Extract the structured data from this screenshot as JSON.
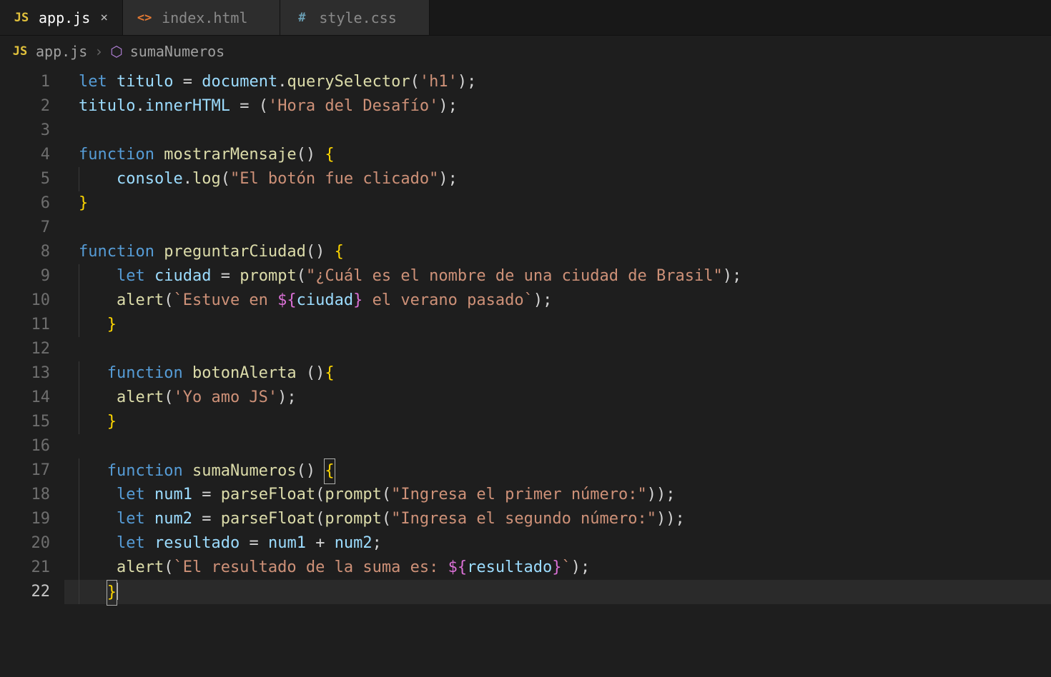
{
  "tabs": [
    {
      "label": "app.js",
      "icon": "JS",
      "iconClass": "js-icon",
      "active": true
    },
    {
      "label": "index.html",
      "icon": "<>",
      "iconClass": "html-icon",
      "active": false
    },
    {
      "label": "style.css",
      "icon": "#",
      "iconClass": "css-icon",
      "active": false
    }
  ],
  "breadcrumbs": {
    "fileIcon": "JS",
    "file": "app.js",
    "sep": "›",
    "symbolIcon": "⬡",
    "symbol": "sumaNumeros"
  },
  "close_icon": "×",
  "code": {
    "line_count": 22,
    "cursor_line": 22,
    "lines": {
      "l1": [
        [
          "kw",
          "let"
        ],
        [
          "pun",
          " "
        ],
        [
          "var",
          "titulo"
        ],
        [
          "pun",
          " "
        ],
        [
          "pun",
          "="
        ],
        [
          "pun",
          " "
        ],
        [
          "var",
          "document"
        ],
        [
          "pun",
          "."
        ],
        [
          "fn",
          "querySelector"
        ],
        [
          "pun",
          "("
        ],
        [
          "str",
          "'h1'"
        ],
        [
          "pun",
          ")"
        ],
        [
          "pun",
          ";"
        ]
      ],
      "l2": [
        [
          "var",
          "titulo"
        ],
        [
          "pun",
          "."
        ],
        [
          "var",
          "innerHTML"
        ],
        [
          "pun",
          " "
        ],
        [
          "pun",
          "="
        ],
        [
          "pun",
          " "
        ],
        [
          "pun",
          "("
        ],
        [
          "str",
          "'Hora del Desafío'"
        ],
        [
          "pun",
          ")"
        ],
        [
          "pun",
          ";"
        ]
      ],
      "l3": [],
      "l4": [
        [
          "kw",
          "function"
        ],
        [
          "pun",
          " "
        ],
        [
          "fn",
          "mostrarMensaje"
        ],
        [
          "pun",
          "()"
        ],
        [
          "pun",
          " "
        ],
        [
          "brace1",
          "{"
        ]
      ],
      "l5": [
        [
          "pun",
          "    "
        ],
        [
          "var",
          "console"
        ],
        [
          "pun",
          "."
        ],
        [
          "fn",
          "log"
        ],
        [
          "pun",
          "("
        ],
        [
          "str",
          "\"El botón fue clicado\""
        ],
        [
          "pun",
          ")"
        ],
        [
          "pun",
          ";"
        ]
      ],
      "l6": [
        [
          "brace1",
          "}"
        ]
      ],
      "l7": [],
      "l8": [
        [
          "kw",
          "function"
        ],
        [
          "pun",
          " "
        ],
        [
          "fn",
          "preguntarCiudad"
        ],
        [
          "pun",
          "()"
        ],
        [
          "pun",
          " "
        ],
        [
          "brace1",
          "{"
        ]
      ],
      "l9": [
        [
          "pun",
          "    "
        ],
        [
          "kw",
          "let"
        ],
        [
          "pun",
          " "
        ],
        [
          "var",
          "ciudad"
        ],
        [
          "pun",
          " "
        ],
        [
          "pun",
          "="
        ],
        [
          "pun",
          " "
        ],
        [
          "fn",
          "prompt"
        ],
        [
          "pun",
          "("
        ],
        [
          "str",
          "\"¿Cuál es el nombre de una ciudad de Brasil\""
        ],
        [
          "pun",
          ")"
        ],
        [
          "pun",
          ";"
        ]
      ],
      "l10": [
        [
          "pun",
          "    "
        ],
        [
          "fn",
          "alert"
        ],
        [
          "pun",
          "("
        ],
        [
          "str",
          "`Estuve en "
        ],
        [
          "brace2",
          "${"
        ],
        [
          "var",
          "ciudad"
        ],
        [
          "brace2",
          "}"
        ],
        [
          "str",
          " el verano pasado`"
        ],
        [
          "pun",
          ")"
        ],
        [
          "pun",
          ";"
        ]
      ],
      "l11": [
        [
          "pun",
          "   "
        ],
        [
          "brace1",
          "}"
        ]
      ],
      "l12": [],
      "l13": [
        [
          "pun",
          "   "
        ],
        [
          "kw",
          "function"
        ],
        [
          "pun",
          " "
        ],
        [
          "fn",
          "botonAlerta"
        ],
        [
          "pun",
          " ()"
        ],
        [
          "brace1",
          "{"
        ]
      ],
      "l14": [
        [
          "pun",
          "    "
        ],
        [
          "fn",
          "alert"
        ],
        [
          "pun",
          "("
        ],
        [
          "str",
          "'Yo amo JS'"
        ],
        [
          "pun",
          ")"
        ],
        [
          "pun",
          ";"
        ]
      ],
      "l15": [
        [
          "pun",
          "   "
        ],
        [
          "brace1",
          "}"
        ]
      ],
      "l16": [],
      "l17": [
        [
          "pun",
          "   "
        ],
        [
          "kw",
          "function"
        ],
        [
          "pun",
          " "
        ],
        [
          "fn",
          "sumaNumeros"
        ],
        [
          "pun",
          "()"
        ],
        [
          "pun",
          " "
        ],
        [
          "brace1box",
          "{"
        ]
      ],
      "l18": [
        [
          "pun",
          "    "
        ],
        [
          "kw",
          "let"
        ],
        [
          "pun",
          " "
        ],
        [
          "var",
          "num1"
        ],
        [
          "pun",
          " "
        ],
        [
          "pun",
          "="
        ],
        [
          "pun",
          " "
        ],
        [
          "fn",
          "parseFloat"
        ],
        [
          "pun",
          "("
        ],
        [
          "fn",
          "prompt"
        ],
        [
          "pun",
          "("
        ],
        [
          "str",
          "\"Ingresa el primer número:\""
        ],
        [
          "pun",
          "))"
        ],
        [
          "pun",
          ";"
        ]
      ],
      "l19": [
        [
          "pun",
          "    "
        ],
        [
          "kw",
          "let"
        ],
        [
          "pun",
          " "
        ],
        [
          "var",
          "num2"
        ],
        [
          "pun",
          " "
        ],
        [
          "pun",
          "="
        ],
        [
          "pun",
          " "
        ],
        [
          "fn",
          "parseFloat"
        ],
        [
          "pun",
          "("
        ],
        [
          "fn",
          "prompt"
        ],
        [
          "pun",
          "("
        ],
        [
          "str",
          "\"Ingresa el segundo número:\""
        ],
        [
          "pun",
          "))"
        ],
        [
          "pun",
          ";"
        ]
      ],
      "l20": [
        [
          "pun",
          "    "
        ],
        [
          "kw",
          "let"
        ],
        [
          "pun",
          " "
        ],
        [
          "var",
          "resultado"
        ],
        [
          "pun",
          " "
        ],
        [
          "pun",
          "="
        ],
        [
          "pun",
          " "
        ],
        [
          "var",
          "num1"
        ],
        [
          "pun",
          " "
        ],
        [
          "pun",
          "+"
        ],
        [
          "pun",
          " "
        ],
        [
          "var",
          "num2"
        ],
        [
          "pun",
          ";"
        ]
      ],
      "l21": [
        [
          "pun",
          "    "
        ],
        [
          "fn",
          "alert"
        ],
        [
          "pun",
          "("
        ],
        [
          "str",
          "`El resultado de la suma es: "
        ],
        [
          "brace2",
          "${"
        ],
        [
          "var",
          "resultado"
        ],
        [
          "brace2",
          "}"
        ],
        [
          "str",
          "`"
        ],
        [
          "pun",
          ")"
        ],
        [
          "pun",
          ";"
        ]
      ],
      "l22": [
        [
          "pun",
          "   "
        ],
        [
          "brace1box",
          "}"
        ],
        [
          "cursor",
          ""
        ]
      ]
    }
  }
}
